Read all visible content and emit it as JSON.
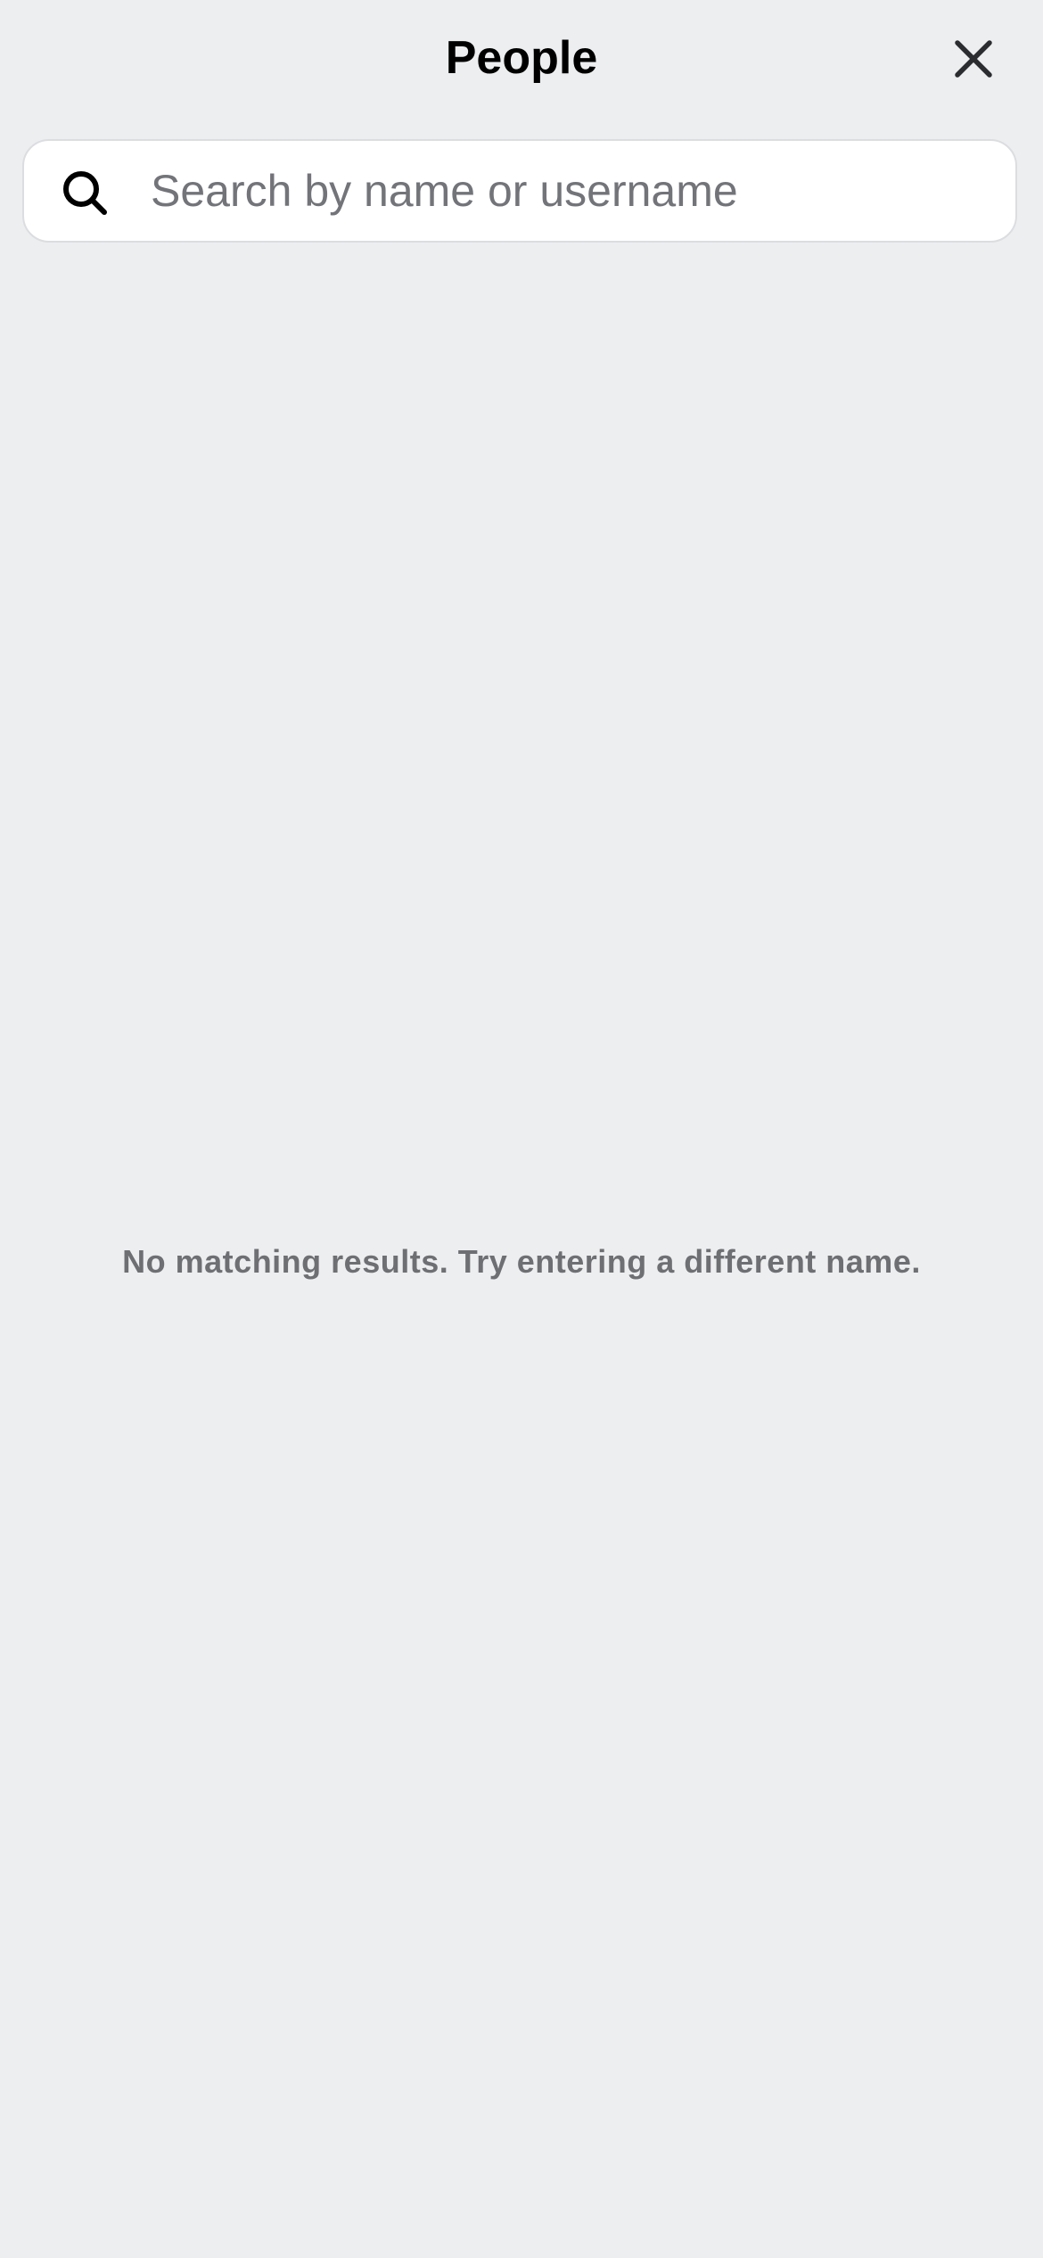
{
  "header": {
    "title": "People",
    "close_icon": "close-icon"
  },
  "search": {
    "icon": "search-icon",
    "placeholder": "Search by name or username",
    "value": ""
  },
  "results": {
    "empty_message": "No matching results. Try entering a different name."
  },
  "colors": {
    "background": "#edeef0",
    "search_background": "#ffffff",
    "search_border": "#dcdde0",
    "placeholder_text": "#737479",
    "secondary_text": "#6e6f73",
    "primary_text": "#000000"
  }
}
